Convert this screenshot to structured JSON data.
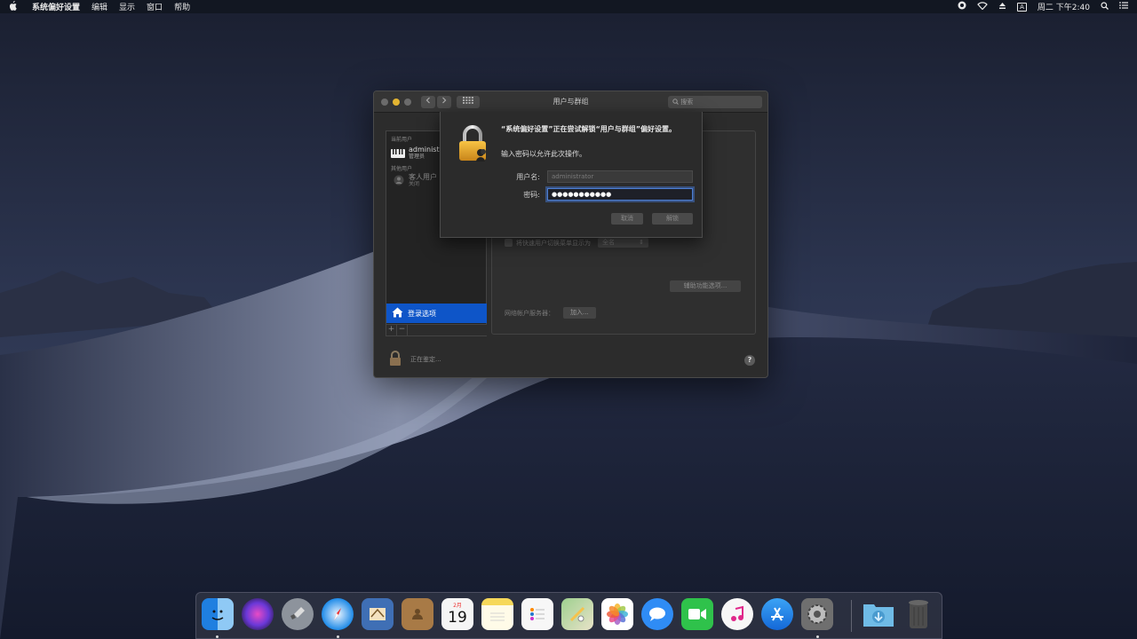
{
  "menubar": {
    "app_name": "系统偏好设置",
    "items": [
      "编辑",
      "显示",
      "窗口",
      "帮助"
    ],
    "input_indicator": "A",
    "clock": "周二 下午2:40"
  },
  "window": {
    "title": "用户与群组",
    "search_placeholder": "搜索",
    "sidebar": {
      "current_users_label": "当前用户",
      "current_user_name": "administ",
      "current_user_role": "管理员",
      "other_users_label": "其他用户",
      "guest_name": "客人用户",
      "guest_status": "关闭",
      "login_options_label": "登录选项",
      "add_label": "+",
      "remove_label": "−"
    },
    "main": {
      "fast_switch_label": "将快速用户切换菜单显示为",
      "fast_switch_value": "全名",
      "accessibility_button": "辅助功能选项...",
      "network_server_label": "网络帐户服务器：",
      "join_button": "加入..."
    },
    "lock_status": "正在鉴定...",
    "help_label": "?"
  },
  "auth_sheet": {
    "message": "“系统偏好设置”正在尝试解锁“用户与群组”偏好设置。",
    "sub_message": "输入密码以允许此次操作。",
    "username_label": "用户名:",
    "username_value": "administrator",
    "password_label": "密码:",
    "password_value": "●●●●●●●●●●●",
    "cancel_button": "取消",
    "unlock_button": "解锁"
  },
  "dock": {
    "apps": [
      {
        "name": "Finder",
        "icon": "finder-icon",
        "color": "#2b8ce6"
      },
      {
        "name": "Siri",
        "icon": "siri-icon",
        "color": "#7a3fd0"
      },
      {
        "name": "Launchpad",
        "icon": "launchpad-icon",
        "color": "#8a8f99"
      },
      {
        "name": "Safari",
        "icon": "safari-icon",
        "color": "#1c8ae8"
      },
      {
        "name": "Mail",
        "icon": "mail-icon",
        "color": "#4f7fc2"
      },
      {
        "name": "Contacts",
        "icon": "contacts-icon",
        "color": "#a87a46"
      },
      {
        "name": "Calendar",
        "icon": "calendar-icon",
        "color": "#f3f3f3",
        "month": "2月",
        "day": "19"
      },
      {
        "name": "Notes",
        "icon": "notes-icon",
        "color": "#f5e07a"
      },
      {
        "name": "Reminders",
        "icon": "reminders-icon",
        "color": "#f7f7f7"
      },
      {
        "name": "Maps",
        "icon": "maps-icon",
        "color": "#7fbf7a"
      },
      {
        "name": "Photos",
        "icon": "photos-icon",
        "color": "#ffffff"
      },
      {
        "name": "Messages",
        "icon": "messages-icon",
        "color": "#2f8cf5"
      },
      {
        "name": "FaceTime",
        "icon": "facetime-icon",
        "color": "#2fc24b"
      },
      {
        "name": "iTunes",
        "icon": "itunes-icon",
        "color": "#f0f0f0"
      },
      {
        "name": "App Store",
        "icon": "app-store-icon",
        "color": "#2a8cf0"
      },
      {
        "name": "System Preferences",
        "icon": "system-preferences-icon",
        "color": "#7a7a7a"
      },
      {
        "name": "Downloads",
        "icon": "downloads-folder-icon",
        "color": "#5fb0e0"
      },
      {
        "name": "Trash",
        "icon": "trash-icon",
        "color": "#5a5a5a"
      }
    ]
  }
}
